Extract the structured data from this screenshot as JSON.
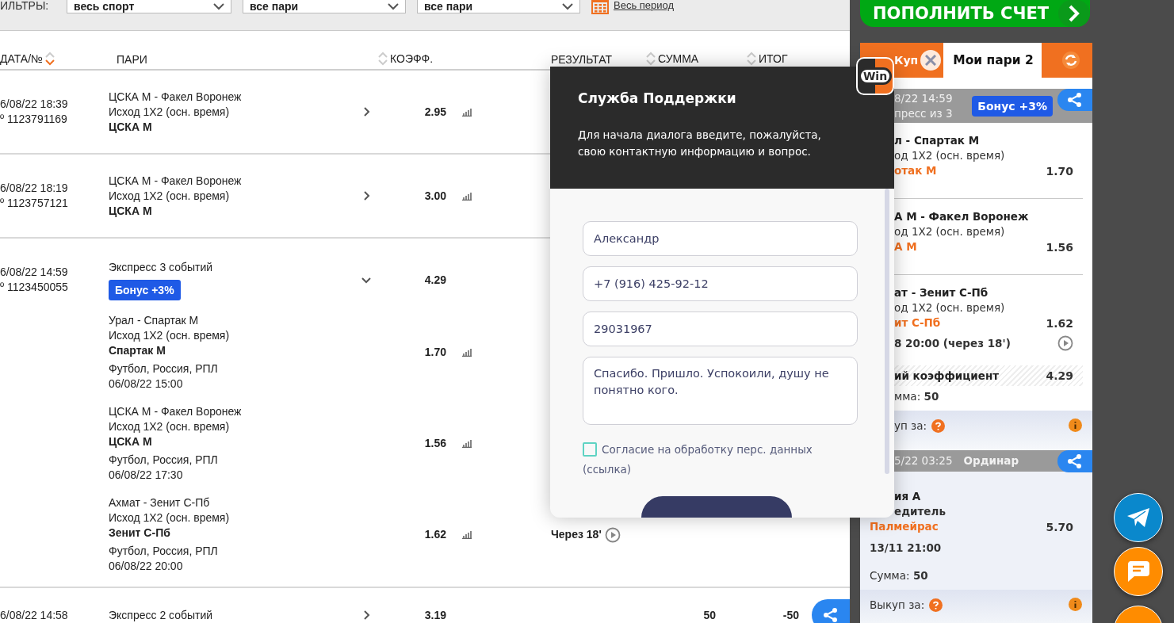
{
  "filters": {
    "label": "ИЛЬТРЫ:",
    "selects": [
      "весь спорт",
      "все пари",
      "все пари"
    ],
    "period_link": "Весь период"
  },
  "table": {
    "columns": [
      {
        "label": "ДАТА/№",
        "sortable": true,
        "sorted": true
      },
      {
        "label": "ПАРИ",
        "sortable": false,
        "sorted": false
      },
      {
        "label": "КОЭФФ.",
        "sortable": true,
        "sorted": false
      },
      {
        "label": "РЕЗУЛЬТАТ",
        "sortable": false,
        "sorted": false
      },
      {
        "label": "СУММА",
        "sortable": true,
        "sorted": false
      },
      {
        "label": "ИТОГ",
        "sortable": true,
        "sorted": false
      }
    ],
    "rows": [
      {
        "kind": "single",
        "date": "6/08/22 18:39",
        "number": "º 1123791169",
        "event": "ЦСКА М - Факел Воронеж",
        "market": "Исход 1X2 (осн. время)",
        "pick": "ЦСКА М",
        "odds": "2.95",
        "expanded": false
      },
      {
        "kind": "single",
        "date": "6/08/22 18:19",
        "number": "º 1123757121",
        "event": "ЦСКА М - Факел Воронеж",
        "market": "Исход 1X2 (осн. время)",
        "pick": "ЦСКА М",
        "odds": "3.00",
        "expanded": false
      },
      {
        "kind": "express",
        "date": "6/08/22 14:59",
        "number": "º 1123450055",
        "title": "Экспресс 3 событий",
        "bonus": "Бонус +3%",
        "odds": "4.29",
        "expanded": true,
        "legs": [
          {
            "event": "Урал - Спартак М",
            "market": "Исход 1X2 (осн. время)",
            "pick": "Спартак М",
            "league": "Футбол, Россия, РПЛ",
            "start": "06/08/22 15:00",
            "odds": "1.70"
          },
          {
            "event": "ЦСКА М - Факел Воронеж",
            "market": "Исход 1X2 (осн. время)",
            "pick": "ЦСКА М",
            "league": "Футбол, Россия, РПЛ",
            "start": "06/08/22 17:30",
            "odds": "1.56"
          },
          {
            "event": "Ахмат - Зенит С-Пб",
            "market": "Исход 1X2 (осн. время)",
            "pick": "Зенит С-Пб",
            "league": "Футбол, Россия, РПЛ",
            "start": "06/08/22 20:00",
            "odds": "1.62",
            "result": "Через 18'"
          }
        ]
      },
      {
        "kind": "express",
        "date": "6/08/22 14:58",
        "title": "Экспресс 2 событий",
        "odds": "3.19",
        "sum": "50",
        "total": "-50",
        "expanded": false
      }
    ]
  },
  "support": {
    "logo": "Win",
    "title": "Служба Поддержки",
    "description": "Для начала диалога введите, пожалуйста, свою контактную информацию и вопрос.",
    "fields": [
      "Александр",
      "+7 (916) 425-92-12",
      "29031967"
    ],
    "message": "Спасибо. Пришло. Успокоили, душу не понятно кого.",
    "consent": {
      "label": "Согласие на обработку перс. данных",
      "link": "(ссылка)",
      "checked": false
    }
  },
  "deposit_button": "ПОПОЛНИТЬ СЧЕТ",
  "coupon": {
    "tabs": [
      {
        "label": "Куп",
        "selected": false
      },
      {
        "label": "Мои пари 2",
        "selected": true
      }
    ],
    "bets": [
      {
        "kind": "express",
        "date": "8/22 14:59",
        "type": "пресс из 3",
        "bonus": "Бонус +3%",
        "legs": [
          {
            "event": "л - Спартак М",
            "market": "од 1X2 (осн. время)",
            "pick": "отак М",
            "odds": "1.70"
          },
          {
            "event": "А М - Факел Воронеж",
            "market": "од 1X2 (осн. время)",
            "pick": "А М",
            "odds": "1.56"
          },
          {
            "event": "ат - Зенит С-Пб",
            "market": "од 1X2 (осн. время)",
            "pick": "ит С-Пб",
            "odds": "1.62",
            "start": "8 20:00 (через 18')"
          }
        ],
        "total_label": "ий коэффициент",
        "total_odds": "4.29",
        "sum_label": "мма:",
        "sum": "50",
        "buyout_label": "уп за:"
      },
      {
        "kind": "single",
        "date": "5/22 03:25",
        "type": "Ординар",
        "legs": [
          {
            "event": "ия А",
            "market": "едитель",
            "pick": "Палмейрас",
            "odds": "5.70",
            "start": "13/11 21:00"
          }
        ],
        "sum_label": "Сумма:",
        "sum": "50",
        "buyout_label": "Выкуп за:"
      }
    ]
  }
}
